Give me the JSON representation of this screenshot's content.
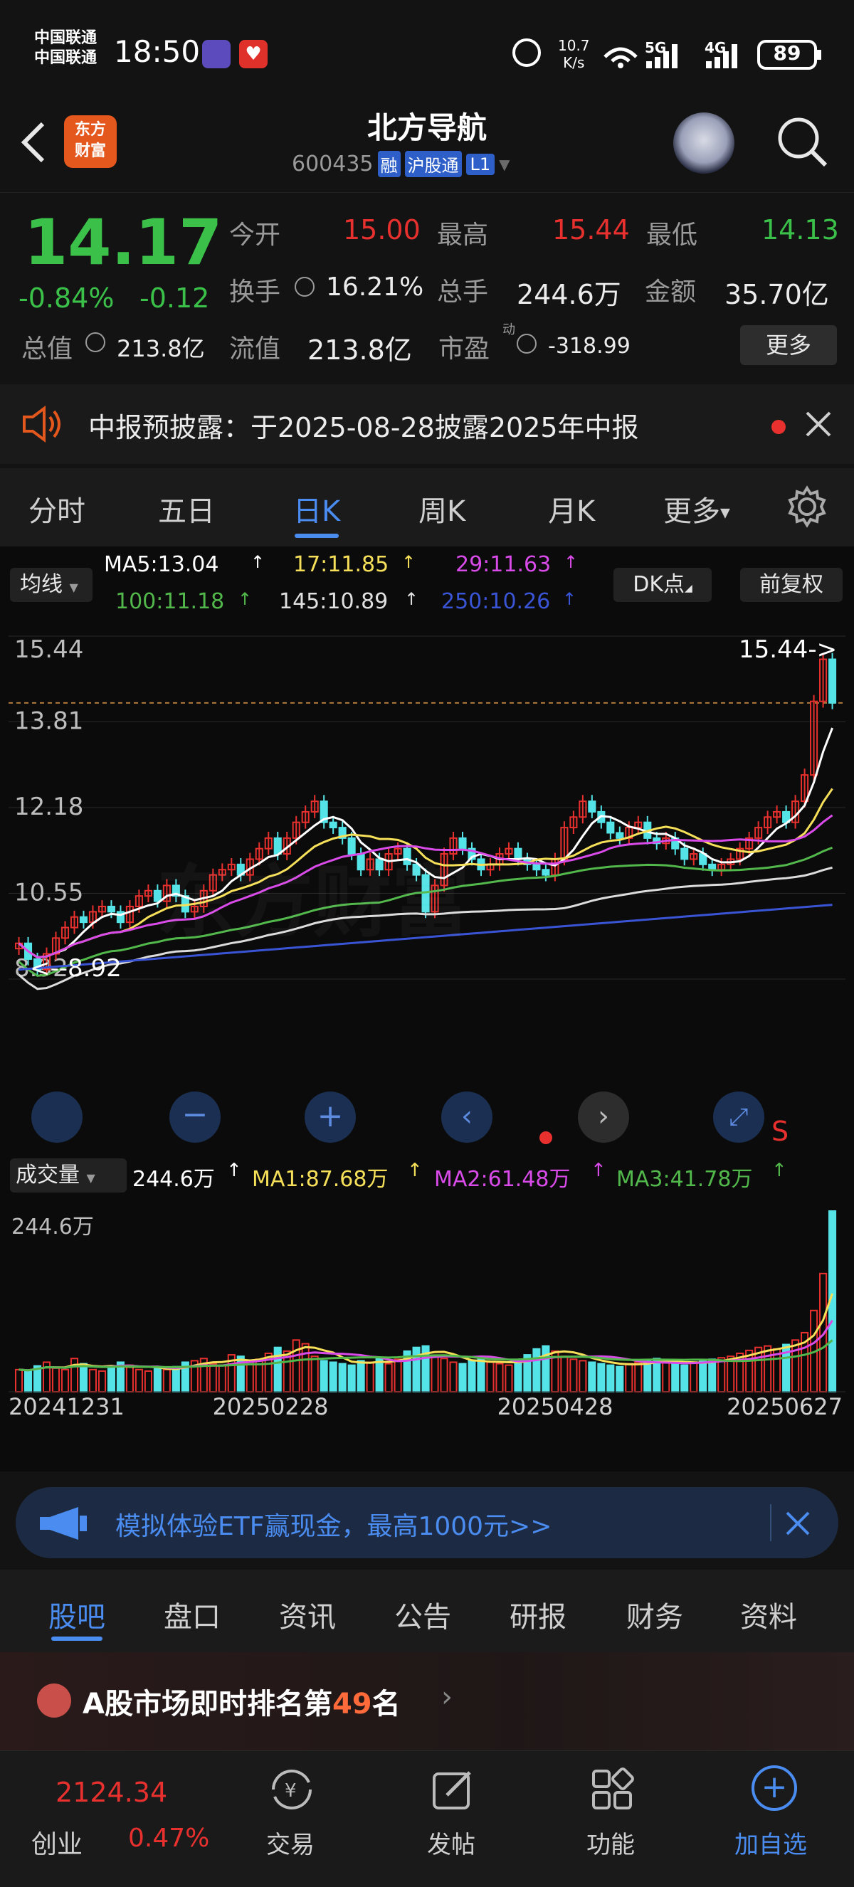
{
  "status_bar": {
    "carrier1": "中国联通",
    "carrier2": "中国联通",
    "time": "18:50",
    "net_speed_value": "10.7",
    "net_speed_unit": "K/s",
    "battery": "89"
  },
  "header": {
    "back_icon": "chevron-left-icon",
    "app_logo_text": "东方\n财富",
    "stock_name": "北方导航",
    "stock_code": "600435",
    "tags": [
      "融",
      "沪股通",
      "L1"
    ],
    "search_icon": "search-icon"
  },
  "quote": {
    "price": "14.17",
    "change_pct": "-0.84%",
    "change_abs": "-0.12",
    "open_label": "今开",
    "open_value": "15.00",
    "high_label": "最高",
    "high_value": "15.44",
    "low_label": "最低",
    "low_value": "14.13",
    "turnover_label": "换手",
    "turnover_value": "16.21%",
    "volume_label": "总手",
    "volume_value": "244.6万",
    "amount_label": "金额",
    "amount_value": "35.70亿",
    "mktcap_label": "总值",
    "mktcap_value": "213.8亿",
    "float_label": "流值",
    "float_value": "213.8亿",
    "pe_label": "市盈",
    "pe_sup": "动",
    "pe_value": "-318.99",
    "more_button": "更多"
  },
  "notice": {
    "text": "中报预披露：于2025-08-28披露2025年中报"
  },
  "period_tabs": [
    "分时",
    "五日",
    "日K",
    "周K",
    "月K",
    "更多"
  ],
  "period_active": 2,
  "indicator_bar": {
    "ma_selector": "均线",
    "ma5": "MA5:13.04",
    "ma17": "17:11.85",
    "ma29": "29:11.63",
    "ma100": "100:11.18",
    "ma145": "145:10.89",
    "ma250": "250:10.26",
    "dk_button": "DK点",
    "adjust_button": "前复权"
  },
  "chart_data": {
    "type": "candlestick",
    "price_axis_labels": [
      "15.44",
      "13.81",
      "12.18",
      "10.55",
      "8.92"
    ],
    "ylim": [
      8.92,
      15.44
    ],
    "high_marker": "15.44->",
    "low_marker": "<--8.92",
    "watermark": "东方财富",
    "x_labels": [
      "20241231",
      "20250228",
      "20250428",
      "20250627"
    ],
    "closes": [
      9.6,
      9.3,
      9.1,
      9.4,
      9.7,
      9.9,
      10.1,
      10.0,
      10.2,
      10.3,
      10.2,
      10.0,
      10.3,
      10.5,
      10.6,
      10.4,
      10.7,
      10.5,
      10.2,
      10.3,
      10.6,
      10.9,
      11.0,
      11.1,
      10.9,
      11.2,
      11.4,
      11.6,
      11.3,
      11.6,
      11.9,
      12.1,
      12.3,
      11.9,
      11.8,
      11.6,
      11.3,
      11.0,
      11.2,
      11.0,
      11.3,
      11.4,
      11.1,
      10.9,
      10.2,
      10.7,
      11.3,
      11.6,
      11.4,
      11.2,
      11.0,
      11.1,
      11.3,
      11.4,
      11.2,
      11.1,
      11.0,
      10.9,
      11.2,
      11.8,
      12.0,
      12.3,
      12.1,
      11.9,
      11.7,
      11.6,
      11.8,
      11.9,
      11.6,
      11.5,
      11.6,
      11.4,
      11.2,
      11.3,
      11.1,
      11.0,
      11.1,
      11.2,
      11.4,
      11.6,
      11.8,
      12.0,
      12.1,
      11.9,
      12.3,
      12.8,
      14.2,
      15.0,
      14.17
    ],
    "volume_label": "成交量",
    "volume_value": "244.6万",
    "volume_axis_max": "244.6万",
    "vol_ma1": "MA1:87.68万",
    "vol_ma2": "MA2:61.48万",
    "vol_ma3": "MA3:41.78万",
    "volumes": [
      30,
      28,
      35,
      40,
      32,
      30,
      45,
      38,
      30,
      28,
      35,
      40,
      36,
      30,
      28,
      32,
      30,
      34,
      40,
      42,
      45,
      38,
      36,
      50,
      48,
      40,
      44,
      52,
      60,
      55,
      70,
      65,
      48,
      42,
      40,
      38,
      36,
      42,
      40,
      46,
      38,
      44,
      55,
      60,
      62,
      48,
      45,
      40,
      38,
      42,
      44,
      40,
      38,
      36,
      42,
      50,
      58,
      62,
      55,
      48,
      44,
      42,
      40,
      38,
      36,
      34,
      38,
      40,
      42,
      45,
      40,
      38,
      36,
      40,
      42,
      44,
      46,
      48,
      52,
      56,
      60,
      62,
      58,
      64,
      70,
      80,
      110,
      160,
      244.6
    ],
    "colors": {
      "up": "#e8312e",
      "down": "#54e3e6",
      "ma5": "#ffffff",
      "ma17": "#f6e05a",
      "ma29": "#d94be8",
      "ma100": "#52b84b",
      "ma145": "#dcdcdc",
      "ma250": "#3a54d6"
    }
  },
  "ad_banner": {
    "text": "模拟体验ETF赢现金，最高1000元>>"
  },
  "bottom_tabs": [
    "股吧",
    "盘口",
    "资讯",
    "公告",
    "研报",
    "财务",
    "资料"
  ],
  "bottom_tab_active": 0,
  "ranking": {
    "prefix": "A股市场即时排名第",
    "rank": "49",
    "suffix": "名"
  },
  "bottom_nav": {
    "index_value": "2124.34",
    "index_name": "创业",
    "index_change": "0.47%",
    "items": [
      "交易",
      "发帖",
      "功能",
      "加自选"
    ]
  }
}
